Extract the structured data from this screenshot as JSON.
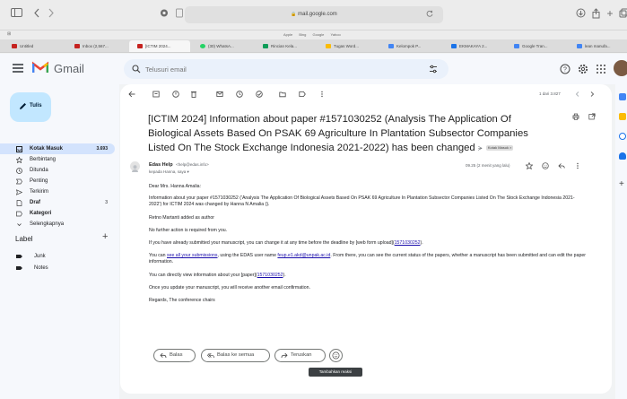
{
  "browser": {
    "address": "mail.google.com",
    "favorites": [
      "Apple",
      "Bing",
      "Google",
      "Yahoo"
    ],
    "tabs": [
      {
        "label": "Untitled",
        "color": "#c5221f"
      },
      {
        "label": "Inbox (2,567...",
        "color": "#c5221f"
      },
      {
        "label": "[ICTIM 2024...",
        "color": "#c5221f"
      },
      {
        "label": "(30) WhatsA...",
        "color": "#25d366"
      },
      {
        "label": "Rincian Kela...",
        "color": "#0f9d58"
      },
      {
        "label": "Tugas Word...",
        "color": "#4285f4"
      },
      {
        "label": "Kelompok P...",
        "color": "#4285f4"
      },
      {
        "label": "EKMAKAYA 2...",
        "color": "#4285f4"
      },
      {
        "label": "Google Tran...",
        "color": "#4285f4"
      },
      {
        "label": "lean manufa...",
        "color": "#4285f4"
      }
    ]
  },
  "header": {
    "app_name": "Gmail",
    "search_placeholder": "Telusuri email"
  },
  "sidebar": {
    "compose_label": "Tulis",
    "items": [
      {
        "label": "Kotak Masuk",
        "count": "3.693",
        "active": true
      },
      {
        "label": "Berbintang",
        "count": ""
      },
      {
        "label": "Ditunda",
        "count": ""
      },
      {
        "label": "Penting",
        "count": ""
      },
      {
        "label": "Terkirim",
        "count": ""
      },
      {
        "label": "Draf",
        "count": "3"
      },
      {
        "label": "Kategori",
        "count": ""
      },
      {
        "label": "Selengkapnya",
        "count": ""
      }
    ],
    "labels_heading": "Label",
    "labels": [
      "Junk",
      "Notes"
    ]
  },
  "message": {
    "pager": "1 dari 3.827",
    "subject": "[ICTIM 2024] Information about paper #1571030252 (Analysis The Application Of Biological Assets Based On PSAK 69 Agriculture In Plantation Subsector Companies Listed On The Stock Exchange Indonesia 2021-2022) has been changed",
    "badge": "Kotak Masuk ×",
    "sender_name": "Edas Help",
    "sender_email": "<help@edas.info>",
    "to": "kepada Hanna, saya ▾",
    "time": "09.25 (2 menit yang lalu)",
    "greeting": "Dear Mrs. Hanna Amalia:",
    "p1": "Information about your paper #1571030252 ('Analysis The Application Of Biological Assets Based On PSAK 69 Agriculture In Plantation Subsector Companies Listed On The Stock Exchange Indonesia 2021-2022') for ICTIM 2024 was changed by Hanna N Amalia ().",
    "p2": "Retno Martanti added as author",
    "p3": "No further action is required from you.",
    "p4_pre": "If you have already submitted your manuscript, you can change it at any time before the deadline by [web form upload](",
    "p4_link": "1571030252",
    "p4_post": ").",
    "p5_pre": "You can ",
    "p5_link1": "see all your submissions",
    "p5_mid": ", using the EDAS user name ",
    "p5_link2": "feup.e1.akd@unpak.ac.id",
    "p5_post": ". From there, you can see the current status of the papers, whether a manuscript has been submitted and can edit the paper information.",
    "p6_pre": "You can directly view information about your [paper](",
    "p6_link": "1571030252",
    "p6_post": ").",
    "p7": "Once you update your manuscript, you will receive another email confirmation.",
    "p8": "Regards, The conference chairs",
    "reply": "Balas",
    "reply_all": "Balas ke semua",
    "forward": "Teruskan",
    "tooltip": "Tambahkan reaksi"
  }
}
